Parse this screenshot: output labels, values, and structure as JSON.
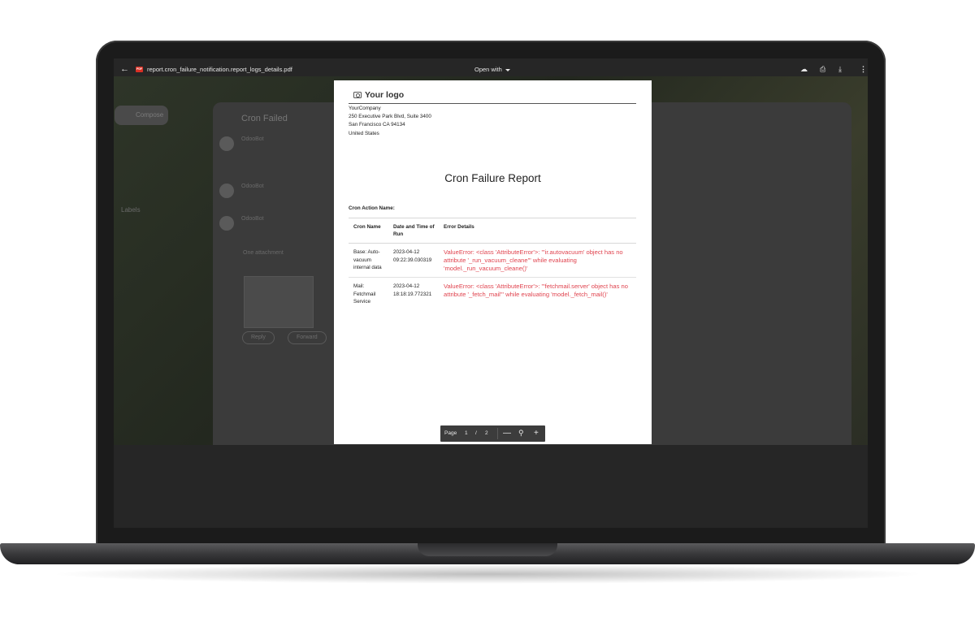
{
  "viewer": {
    "filename": "report.cron_failure_notification.report_logs_details.pdf",
    "file_badge": "PDF",
    "open_with": "Open with",
    "icons": [
      "back-arrow-icon",
      "pdf-file-icon",
      "add-to-drive-icon",
      "print-icon",
      "download-icon",
      "more-vert-icon"
    ]
  },
  "background_app": {
    "compose": "Compose",
    "subject": "Cron Failed",
    "sender": "OdooBot",
    "attachment": "One attachment",
    "reply": "Reply",
    "forward": "Forward",
    "labels": "Labels"
  },
  "report": {
    "logo": "Your logo",
    "company": {
      "name": "YourCompany",
      "street": "250 Executive Park Blvd, Suite 3400",
      "city": "San Francisco CA 94134",
      "country": "United States"
    },
    "title": "Cron Failure Report",
    "action_label": "Cron Action Name:",
    "columns": [
      "Cron Name",
      "Date and Time of Run",
      "Error Details"
    ],
    "rows": [
      {
        "name": "Base: Auto-vacuum internal data",
        "datetime": "2023-04-12 09:22:39.030319",
        "error": "ValueError: <class 'AttributeError'>: \"'ir.autovacuum' object has no attribute '_run_vacuum_cleane'\" while evaluating 'model._run_vacuum_cleane()'"
      },
      {
        "name": "Mail: Fetchmail Service",
        "datetime": "2023-04-12 18:18:19.772321",
        "error": "ValueError: <class 'AttributeError'>: \"'fetchmail.server' object has no attribute '_fetch_mail'\" while evaluating 'model._fetch_mail()'"
      }
    ]
  },
  "pager": {
    "label": "Page",
    "current": "1",
    "separator": "/",
    "total": "2",
    "zoom_out": "—",
    "zoom_in": "+"
  }
}
